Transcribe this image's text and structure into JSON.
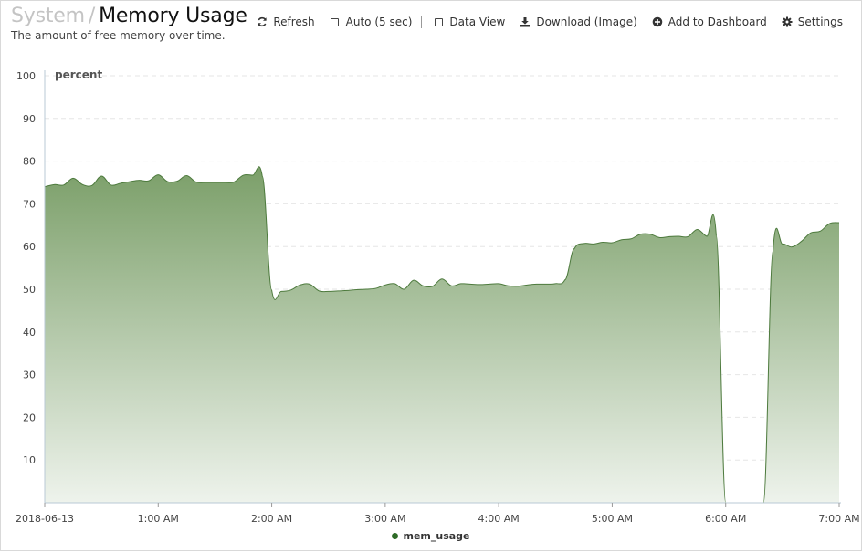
{
  "header": {
    "breadcrumb_parent": "System",
    "breadcrumb_separator": "/",
    "title": "Memory Usage",
    "subtitle": "The amount of free memory over time."
  },
  "toolbar": {
    "refresh_label": "Refresh",
    "auto_label": "Auto (5 sec)",
    "data_view_label": "Data View",
    "download_label": "Download (Image)",
    "add_dashboard_label": "Add to Dashboard",
    "settings_label": "Settings"
  },
  "colors": {
    "series_line": "#4d7a3d",
    "series_fill_top": "#7b9f69",
    "series_fill_bottom": "#eef3ec",
    "legend_dot": "#2e6b27"
  },
  "chart_data": {
    "type": "area",
    "title": "",
    "ylabel": "percent",
    "ylim": [
      0,
      100
    ],
    "yticks": [
      10,
      20,
      30,
      40,
      50,
      60,
      70,
      80,
      90,
      100
    ],
    "xlim": [
      "2018-06-13 00:00",
      "2018-06-13 07:00"
    ],
    "xticks": [
      {
        "t": "00:00",
        "label": "2018-06-13"
      },
      {
        "t": "01:00",
        "label": "1:00 AM"
      },
      {
        "t": "02:00",
        "label": "2:00 AM"
      },
      {
        "t": "03:00",
        "label": "3:00 AM"
      },
      {
        "t": "04:00",
        "label": "4:00 AM"
      },
      {
        "t": "05:00",
        "label": "5:00 AM"
      },
      {
        "t": "06:00",
        "label": "6:00 AM"
      },
      {
        "t": "07:00",
        "label": "7:00 AM"
      }
    ],
    "grid": true,
    "legend_position": "bottom",
    "series": [
      {
        "name": "mem_usage",
        "points": [
          [
            "00:00",
            74.0
          ],
          [
            "00:05",
            74.5
          ],
          [
            "00:10",
            74.4
          ],
          [
            "00:15",
            76.0
          ],
          [
            "00:20",
            74.5
          ],
          [
            "00:25",
            74.3
          ],
          [
            "00:30",
            76.5
          ],
          [
            "00:35",
            74.4
          ],
          [
            "00:40",
            74.8
          ],
          [
            "00:45",
            75.2
          ],
          [
            "00:50",
            75.5
          ],
          [
            "00:55",
            75.4
          ],
          [
            "01:00",
            76.8
          ],
          [
            "01:05",
            75.2
          ],
          [
            "01:10",
            75.3
          ],
          [
            "01:15",
            76.6
          ],
          [
            "01:20",
            75.1
          ],
          [
            "01:25",
            75.0
          ],
          [
            "01:30",
            75.0
          ],
          [
            "01:35",
            75.0
          ],
          [
            "01:40",
            75.1
          ],
          [
            "01:45",
            76.7
          ],
          [
            "01:50",
            76.7
          ],
          [
            "01:55",
            76.5
          ],
          [
            "02:00",
            49.8
          ],
          [
            "02:05",
            49.5
          ],
          [
            "02:10",
            49.8
          ],
          [
            "02:15",
            51.0
          ],
          [
            "02:20",
            51.2
          ],
          [
            "02:25",
            49.6
          ],
          [
            "02:30",
            49.5
          ],
          [
            "02:35",
            49.6
          ],
          [
            "02:40",
            49.7
          ],
          [
            "02:45",
            49.9
          ],
          [
            "02:50",
            50.0
          ],
          [
            "02:55",
            50.2
          ],
          [
            "03:00",
            51.0
          ],
          [
            "03:05",
            51.3
          ],
          [
            "03:10",
            50.0
          ],
          [
            "03:15",
            52.1
          ],
          [
            "03:20",
            50.8
          ],
          [
            "03:25",
            50.7
          ],
          [
            "03:30",
            52.4
          ],
          [
            "03:35",
            50.8
          ],
          [
            "03:40",
            51.3
          ],
          [
            "03:45",
            51.2
          ],
          [
            "03:50",
            51.1
          ],
          [
            "03:55",
            51.2
          ],
          [
            "04:00",
            51.3
          ],
          [
            "04:05",
            50.8
          ],
          [
            "04:10",
            50.7
          ],
          [
            "04:15",
            51.0
          ],
          [
            "04:20",
            51.2
          ],
          [
            "04:25",
            51.2
          ],
          [
            "04:30",
            51.3
          ],
          [
            "04:35",
            52.2
          ],
          [
            "04:40",
            59.5
          ],
          [
            "04:45",
            60.7
          ],
          [
            "04:50",
            60.6
          ],
          [
            "04:55",
            61.0
          ],
          [
            "05:00",
            60.9
          ],
          [
            "05:05",
            61.6
          ],
          [
            "05:10",
            61.8
          ],
          [
            "05:15",
            62.9
          ],
          [
            "05:20",
            62.9
          ],
          [
            "05:25",
            62.1
          ],
          [
            "05:30",
            62.3
          ],
          [
            "05:35",
            62.4
          ],
          [
            "05:40",
            62.3
          ],
          [
            "05:45",
            64.0
          ],
          [
            "05:50",
            62.4
          ],
          [
            "05:55",
            62.6
          ],
          [
            "06:00",
            0.0
          ],
          [
            "06:05",
            0.0
          ],
          [
            "06:10",
            0.0
          ],
          [
            "06:15",
            0.0
          ],
          [
            "06:20",
            0.0
          ],
          [
            "06:25",
            59.0
          ],
          [
            "06:30",
            60.6
          ],
          [
            "06:35",
            59.9
          ],
          [
            "06:40",
            61.2
          ],
          [
            "06:45",
            63.2
          ],
          [
            "06:50",
            63.6
          ],
          [
            "06:55",
            65.4
          ],
          [
            "07:00",
            65.6
          ]
        ]
      }
    ]
  }
}
